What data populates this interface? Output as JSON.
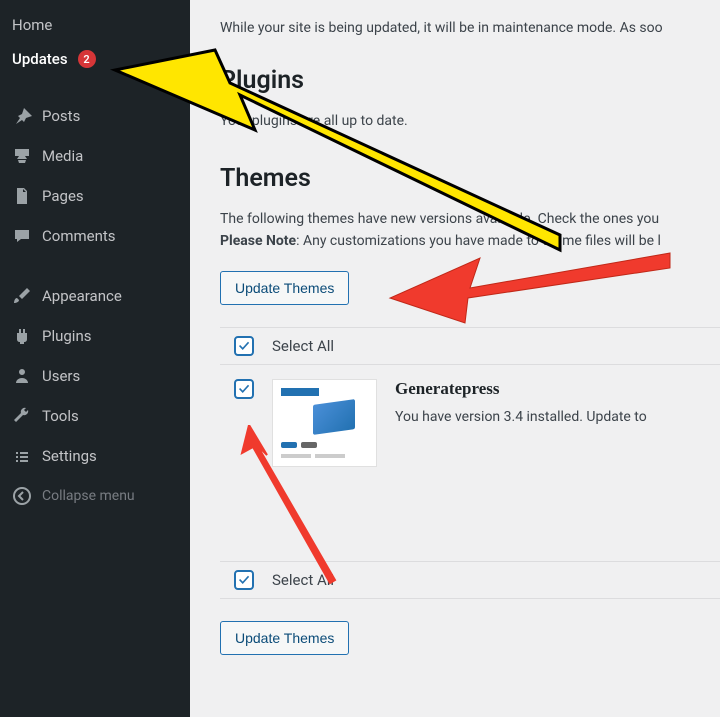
{
  "sidebar": {
    "home": "Home",
    "updates": "Updates",
    "updates_count": "2",
    "posts": "Posts",
    "media": "Media",
    "pages": "Pages",
    "comments": "Comments",
    "appearance": "Appearance",
    "plugins": "Plugins",
    "users": "Users",
    "tools": "Tools",
    "settings": "Settings",
    "collapse": "Collapse menu"
  },
  "content": {
    "maintenance_text": "While your site is being updated, it will be in maintenance mode. As soo",
    "plugins_heading": "Plugins",
    "plugins_text": "Your plugins are all up to date.",
    "themes_heading": "Themes",
    "themes_text1": "The following themes have new versions available. Check the ones you ",
    "note_label": "Please Note",
    "themes_text2": ": Any customizations you have made to theme files will be l",
    "update_themes_btn": "Update Themes",
    "select_all": "Select All",
    "theme_name": "Generatepress",
    "theme_version": "You have version 3.4 installed. Update to"
  }
}
